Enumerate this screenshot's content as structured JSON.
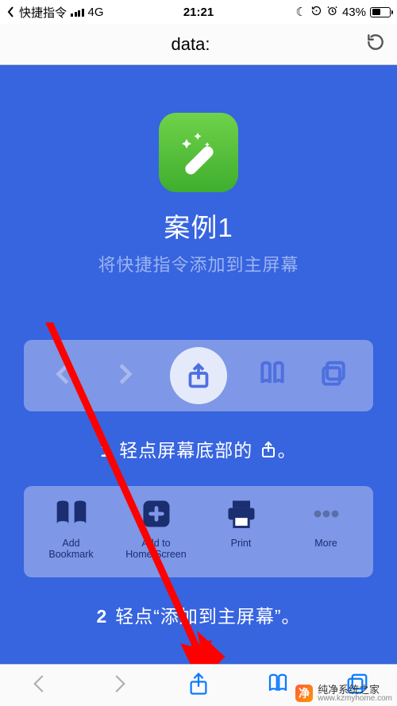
{
  "status": {
    "back_app": "快捷指令",
    "network": "4G",
    "time": "21:21",
    "moon": "☾",
    "lock": "⟳",
    "alarm": "⏰",
    "battery_pct": "43%",
    "battery_fill": 43
  },
  "address_bar": {
    "url": "data:"
  },
  "page": {
    "app_title": "案例1",
    "app_subtitle": "将快捷指令添加到主屏幕",
    "step1_num": "1",
    "step1_text_a": "轻点屏幕底部的 ",
    "step1_text_b": "。",
    "step2_num": "2",
    "step2_text": "轻点“添加到主屏幕”。",
    "share_sheet": {
      "add_bookmark": "Add\nBookmark",
      "add_home": "Add to\nHome Screen",
      "print": "Print",
      "more": "More"
    }
  },
  "watermark": {
    "name": "纯净系统之家",
    "site": "www.kzmyhome.com"
  }
}
